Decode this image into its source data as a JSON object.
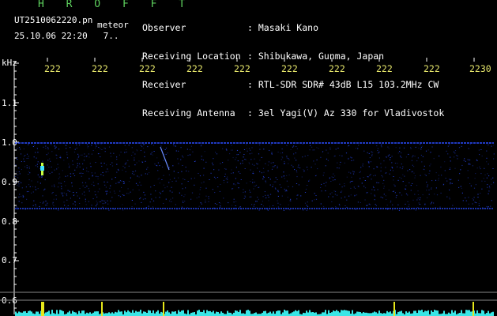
{
  "header": {
    "brand": "H R O F F T",
    "file_name": "UT2510062220.pn",
    "meteor_tag": "meteor",
    "timestamp": "25.10.06 22:20   7..",
    "meta": [
      {
        "label": "Observer",
        "value": ": Masaki Kano"
      },
      {
        "label": "Receiving Location",
        "value": ": Shibukawa, Gunma, Japan"
      },
      {
        "label": "Receiver",
        "value": ": RTL-SDR SDR# 43dB L15 103.2MHz CW"
      },
      {
        "label": "Receiving Antenna",
        "value": ": 3el Yagi(V) Az 330 for Vladivostok"
      }
    ]
  },
  "axis": {
    "y_unit": "kHz",
    "x_ticks": [
      "222",
      "222",
      "222",
      "222",
      "222",
      "222",
      "222",
      "222",
      "222",
      "2230"
    ],
    "y_ticks": [
      "1.1",
      "1.0",
      "0.9",
      "0.8",
      "0.7",
      "0.6"
    ]
  },
  "colors": {
    "background": "#000000",
    "brand": "#5fd35f",
    "tick_label": "#e6e66b",
    "signal": "#2a4cff",
    "spectrum": "#39e6e6",
    "spike": "#e6e61a"
  }
}
